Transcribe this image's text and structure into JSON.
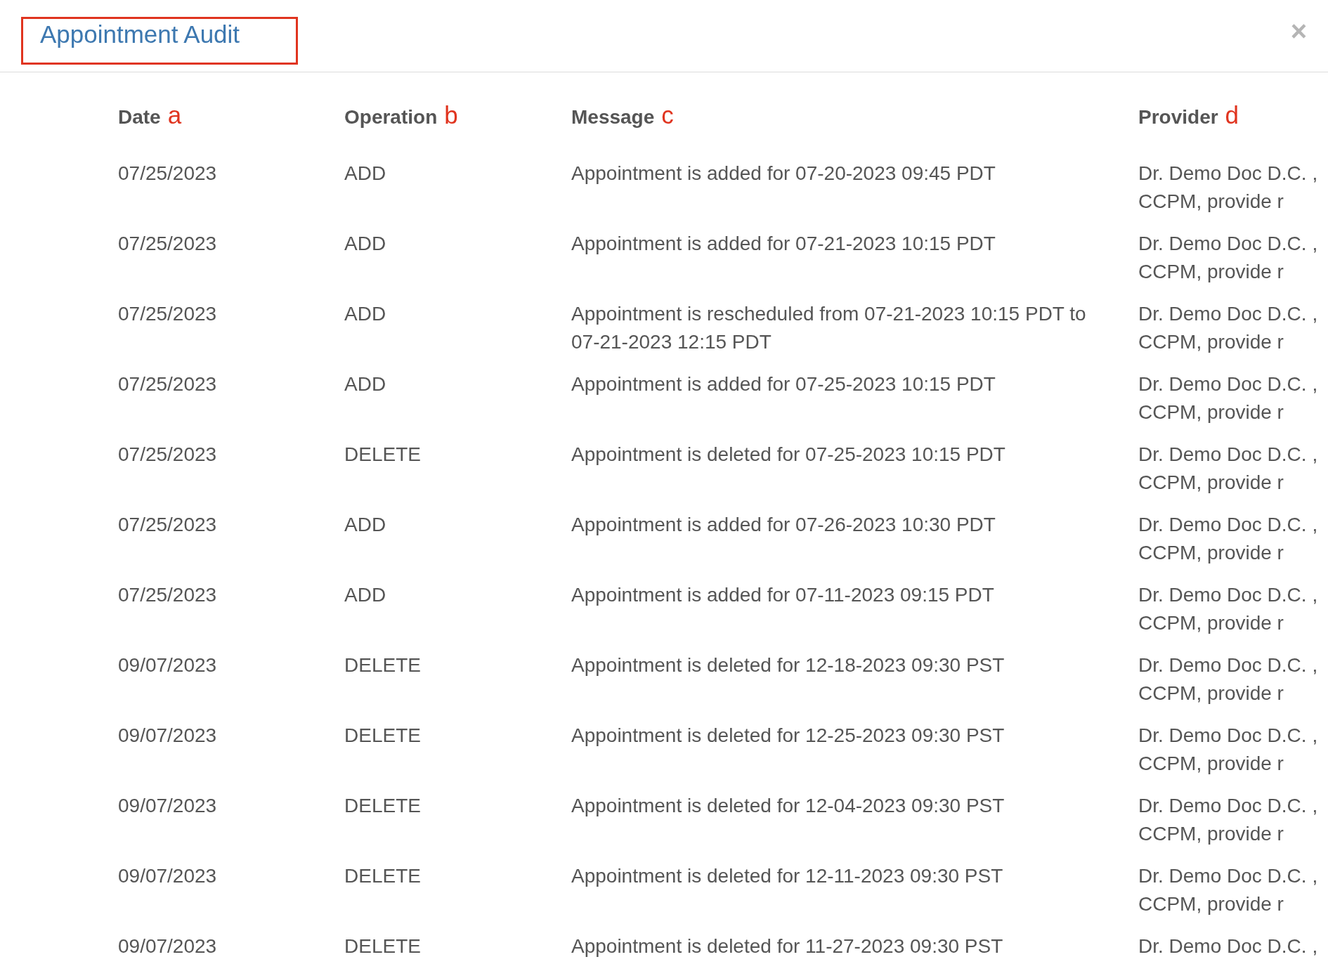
{
  "dialog": {
    "title": "Appointment Audit",
    "close": "×"
  },
  "table": {
    "columns": [
      {
        "label": "Date",
        "marker": "a"
      },
      {
        "label": "Operation",
        "marker": "b"
      },
      {
        "label": "Message",
        "marker": "c"
      },
      {
        "label": "Provider",
        "marker": "d"
      }
    ],
    "rows": [
      {
        "date": "07/25/2023",
        "operation": "ADD",
        "message": "Appointment is added for 07-20-2023 09:45 PDT",
        "provider": "Dr. Demo Doc D.C. , CCPM, provide r"
      },
      {
        "date": "07/25/2023",
        "operation": "ADD",
        "message": "Appointment is added for 07-21-2023 10:15 PDT",
        "provider": "Dr. Demo Doc D.C. , CCPM, provide r"
      },
      {
        "date": "07/25/2023",
        "operation": "ADD",
        "message": "Appointment is rescheduled from 07-21-2023 10:15 PDT to 07-21-2023 12:15 PDT",
        "provider": "Dr. Demo Doc D.C. , CCPM, provide r"
      },
      {
        "date": "07/25/2023",
        "operation": "ADD",
        "message": "Appointment is added for 07-25-2023 10:15 PDT",
        "provider": "Dr. Demo Doc D.C. , CCPM, provide r"
      },
      {
        "date": "07/25/2023",
        "operation": "DELETE",
        "message": "Appointment is deleted for 07-25-2023 10:15 PDT",
        "provider": "Dr. Demo Doc D.C. , CCPM, provide r"
      },
      {
        "date": "07/25/2023",
        "operation": "ADD",
        "message": "Appointment is added for 07-26-2023 10:30 PDT",
        "provider": "Dr. Demo Doc D.C. , CCPM, provide r"
      },
      {
        "date": "07/25/2023",
        "operation": "ADD",
        "message": "Appointment is added for 07-11-2023 09:15 PDT",
        "provider": "Dr. Demo Doc D.C. , CCPM, provide r"
      },
      {
        "date": "09/07/2023",
        "operation": "DELETE",
        "message": "Appointment is deleted for 12-18-2023 09:30 PST",
        "provider": "Dr. Demo Doc D.C. , CCPM, provide r"
      },
      {
        "date": "09/07/2023",
        "operation": "DELETE",
        "message": "Appointment is deleted for 12-25-2023 09:30 PST",
        "provider": "Dr. Demo Doc D.C. , CCPM, provide r"
      },
      {
        "date": "09/07/2023",
        "operation": "DELETE",
        "message": "Appointment is deleted for 12-04-2023 09:30 PST",
        "provider": "Dr. Demo Doc D.C. , CCPM, provide r"
      },
      {
        "date": "09/07/2023",
        "operation": "DELETE",
        "message": "Appointment is deleted for 12-11-2023 09:30 PST",
        "provider": "Dr. Demo Doc D.C. , CCPM, provide r"
      },
      {
        "date": "09/07/2023",
        "operation": "DELETE",
        "message": "Appointment is deleted for 11-27-2023 09:30 PST",
        "provider": "Dr. Demo Doc D.C. ,"
      }
    ]
  }
}
